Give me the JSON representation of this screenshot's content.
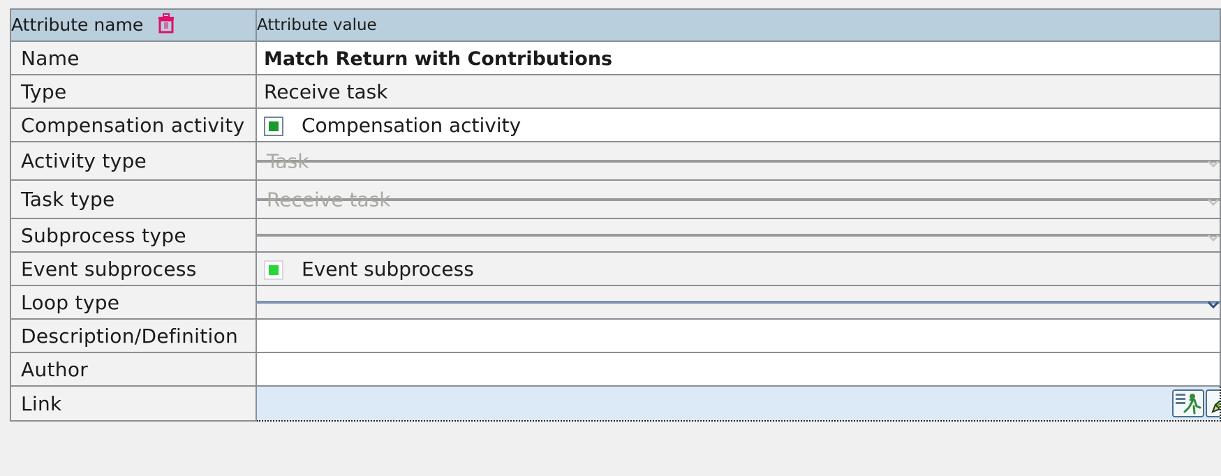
{
  "header": {
    "name_label": "Attribute name",
    "value_label": "Attribute value"
  },
  "rows": {
    "name": {
      "label": "Name",
      "value": "Match Return with Contributions"
    },
    "type": {
      "label": "Type",
      "value": "Receive task"
    },
    "compensation": {
      "label": "Compensation activity",
      "checkbox_label": "Compensation activity",
      "checked": true
    },
    "activity_type": {
      "label": "Activity type",
      "value": "Task"
    },
    "task_type": {
      "label": "Task type",
      "value": "Receive task"
    },
    "subprocess_type": {
      "label": "Subprocess type",
      "value": ""
    },
    "event_subprocess": {
      "label": "Event subprocess",
      "checkbox_label": "Event subprocess",
      "checked": true
    },
    "loop_type": {
      "label": "Loop type",
      "value": ""
    },
    "description": {
      "label": "Description/Definition",
      "value": ""
    },
    "author": {
      "label": "Author",
      "value": ""
    },
    "link": {
      "label": "Link",
      "value": ""
    }
  },
  "icons": {
    "header_icon": "trash-icon",
    "link_open": "run-link-icon",
    "link_edit": "pencil-icon"
  },
  "colors": {
    "header_bg": "#b9cfdd",
    "checkbox_green_dark": "#1a9a2a",
    "checkbox_green_light": "#24d83a",
    "link_bg": "#dce9f6",
    "trash_icon": "#e0106c"
  }
}
